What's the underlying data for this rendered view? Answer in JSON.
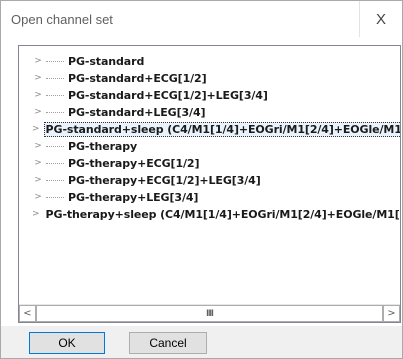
{
  "dialog": {
    "title": "Open channel set",
    "close_symbol": "X"
  },
  "tree": {
    "expander_symbol": ">",
    "selected_index": 4,
    "items": [
      {
        "label": "PG-standard"
      },
      {
        "label": "PG-standard+ECG[1/2]"
      },
      {
        "label": "PG-standard+ECG[1/2]+LEG[3/4]"
      },
      {
        "label": "PG-standard+LEG[3/4]"
      },
      {
        "label": "PG-standard+sleep (C4/M1[1/4]+EOGri/M1[2/4]+EOGle/M1"
      },
      {
        "label": "PG-therapy"
      },
      {
        "label": "PG-therapy+ECG[1/2]"
      },
      {
        "label": "PG-therapy+ECG[1/2]+LEG[3/4]"
      },
      {
        "label": "PG-therapy+LEG[3/4]"
      },
      {
        "label": "PG-therapy+sleep (C4/M1[1/4]+EOGri/M1[2/4]+EOGle/M1[3"
      }
    ]
  },
  "scrollbar": {
    "left_arrow": "<",
    "right_arrow": ">",
    "grip": "III"
  },
  "buttons": {
    "ok_label": "OK",
    "cancel_label": "Cancel"
  }
}
